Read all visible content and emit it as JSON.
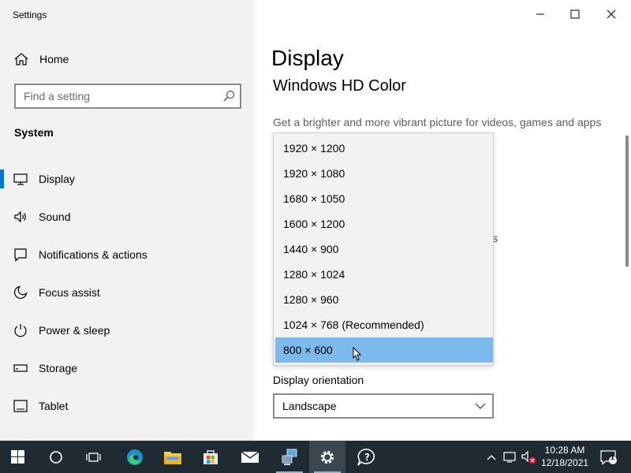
{
  "window": {
    "title": "Settings"
  },
  "sidebar": {
    "home_label": "Home",
    "search_placeholder": "Find a setting",
    "section_title": "System",
    "items": [
      {
        "label": "Display",
        "icon": "display-icon",
        "active": true
      },
      {
        "label": "Sound",
        "icon": "speaker-icon"
      },
      {
        "label": "Notifications & actions",
        "icon": "notification-icon"
      },
      {
        "label": "Focus assist",
        "icon": "moon-icon"
      },
      {
        "label": "Power & sleep",
        "icon": "power-icon"
      },
      {
        "label": "Storage",
        "icon": "storage-icon"
      },
      {
        "label": "Tablet",
        "icon": "tablet-icon"
      }
    ]
  },
  "main": {
    "title": "Display",
    "subtitle": "Windows HD Color",
    "description": "Get a brighter and more vibrant picture for videos, games and apps",
    "partially_hidden_text": "s",
    "orientation_label": "Display orientation",
    "orientation_value": "Landscape"
  },
  "resolution_dropdown": {
    "options": [
      "1920 × 1200",
      "1920 × 1080",
      "1680 × 1050",
      "1600 × 1200",
      "1440 × 900",
      "1280 × 1024",
      "1280 × 960",
      "1024 × 768 (Recommended)",
      "800 × 600"
    ],
    "selected": "800 × 600"
  },
  "taskbar": {
    "apps": [
      "start-icon",
      "search-circle-icon",
      "task-view-icon",
      "edge-icon",
      "file-explorer-icon",
      "store-icon",
      "mail-icon",
      "network-app-icon",
      "settings-icon",
      "feedback-hub-icon"
    ],
    "time": "10:28 AM",
    "date": "12/18/2021",
    "notification_count": "1"
  },
  "colors": {
    "accent": "#0078d7",
    "sidebar_bg": "#f2f2f2",
    "dropdown_highlight": "#7cb9ec",
    "taskbar_bg": "#1f2a33"
  }
}
